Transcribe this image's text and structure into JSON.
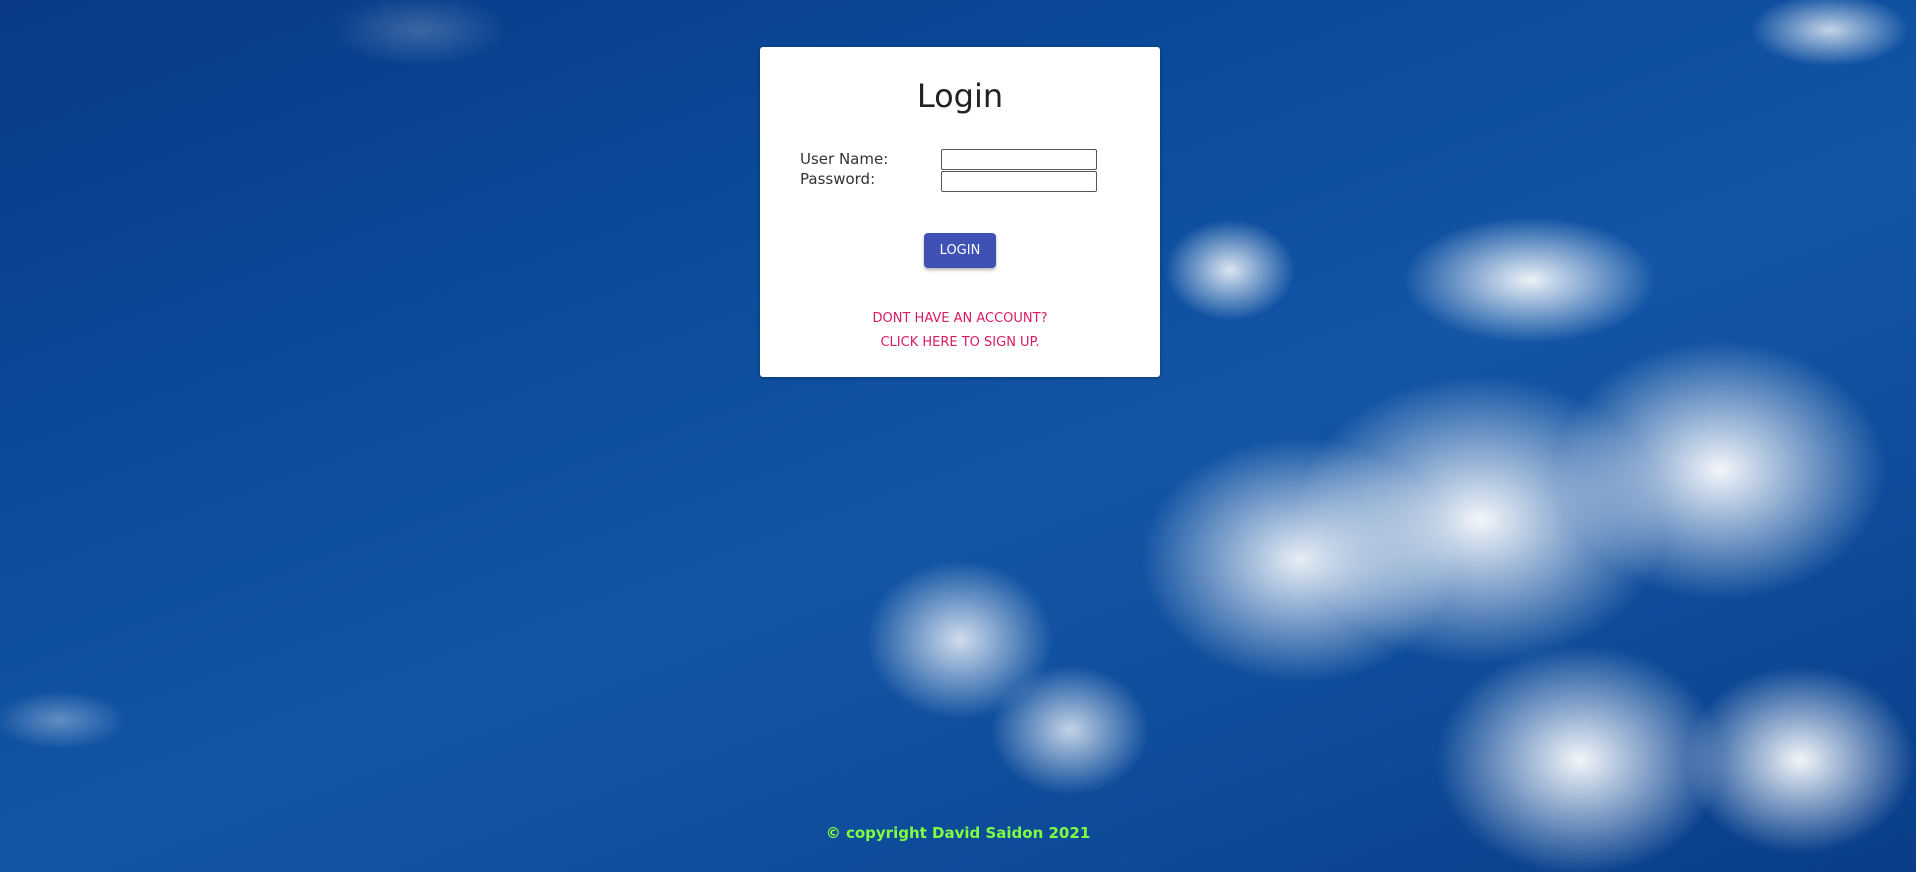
{
  "login": {
    "title": "Login",
    "username_label": "User Name:",
    "password_label": "Password:",
    "username_value": "",
    "password_value": "",
    "button_label": "LOGIN",
    "signup_line1": "DONT HAVE AN ACCOUNT?",
    "signup_line2": "CLICK HERE TO SIGN UP."
  },
  "footer": {
    "copyright": "© copyright David Saidon 2021"
  },
  "colors": {
    "button_bg": "#3f51b5",
    "link": "#d81b60",
    "copyright": "#7fff3f",
    "sky": "#0d4a98"
  }
}
